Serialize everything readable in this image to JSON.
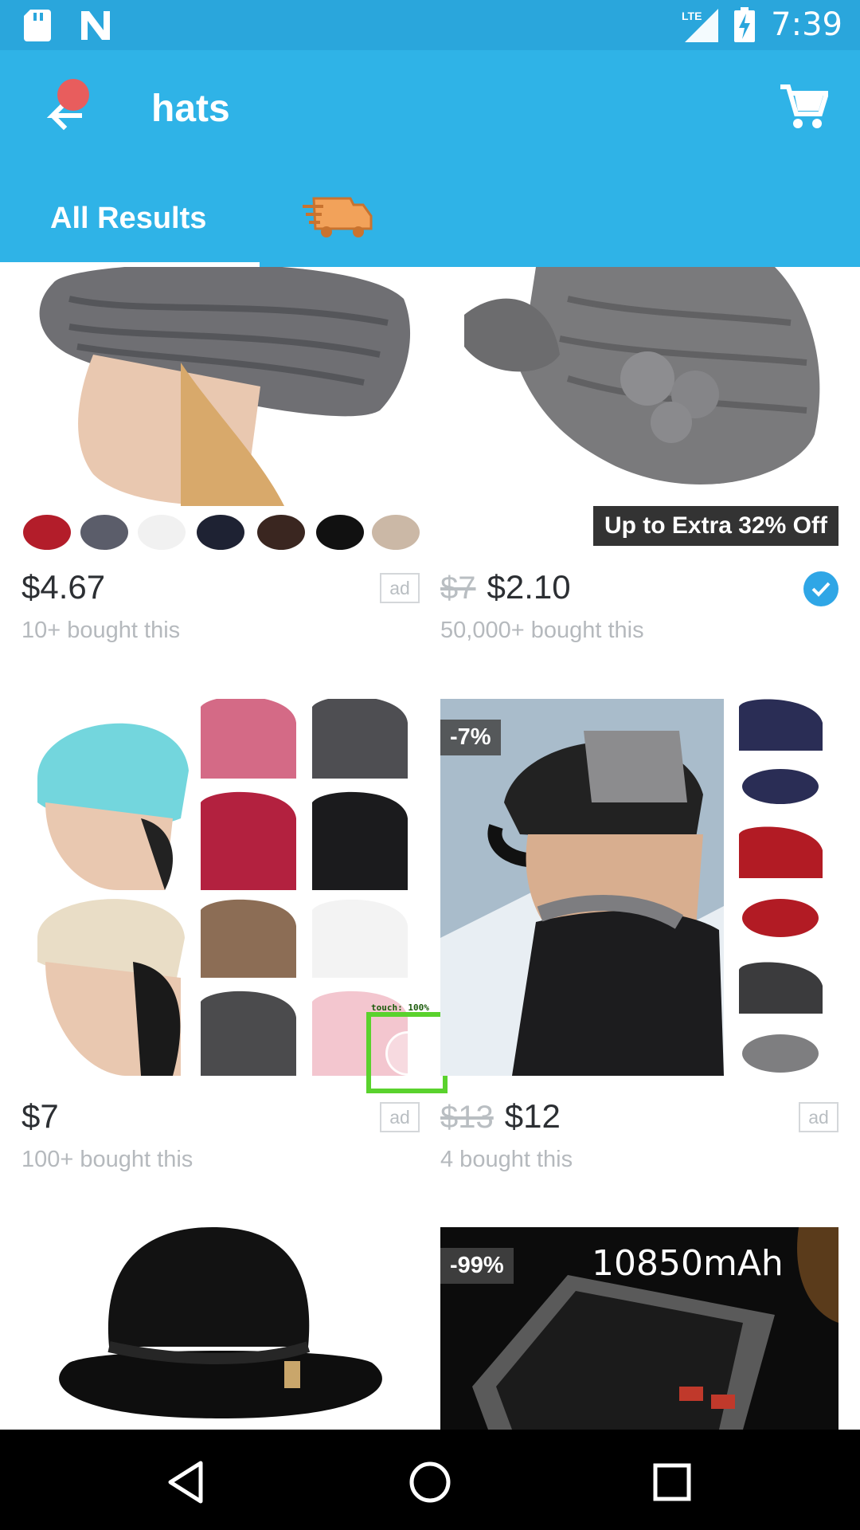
{
  "status_bar": {
    "time": "7:39",
    "network": "LTE"
  },
  "header": {
    "title": "hats",
    "back_icon": "arrow-left-icon",
    "cart_icon": "shopping-cart-icon"
  },
  "tabs": [
    {
      "label": "All Results",
      "active": true
    },
    {
      "label": "",
      "icon": "fast-delivery-truck-icon",
      "active": false
    }
  ],
  "products": [
    {
      "price": "$4.67",
      "old_price": "",
      "sold": "10+ bought this",
      "badge": "ad",
      "tag": "",
      "banner": ""
    },
    {
      "price": "$2.10",
      "old_price": "$7",
      "sold": "50,000+ bought this",
      "badge": "verified",
      "tag": "",
      "banner": "Up to Extra 32% Off"
    },
    {
      "price": "$7",
      "old_price": "",
      "sold": "100+ bought this",
      "badge": "ad",
      "tag": "",
      "banner": ""
    },
    {
      "price": "$12",
      "old_price": "$13",
      "sold": "4 bought this",
      "badge": "ad",
      "tag": "-7%",
      "banner": ""
    },
    {
      "price": "",
      "old_price": "",
      "sold": "",
      "badge": "",
      "tag": "",
      "banner": ""
    },
    {
      "price": "",
      "old_price": "",
      "sold": "",
      "badge": "",
      "tag": "-99%",
      "banner": "",
      "image_text": "10850mAh"
    }
  ],
  "touch_indicator": {
    "label": "touch: 100%"
  },
  "colors": {
    "header": "#2fb3e7",
    "status_bar": "#2aa6dc",
    "accent": "#2fa6e6",
    "price": "#2c2f33",
    "muted": "#b5b9bd"
  }
}
